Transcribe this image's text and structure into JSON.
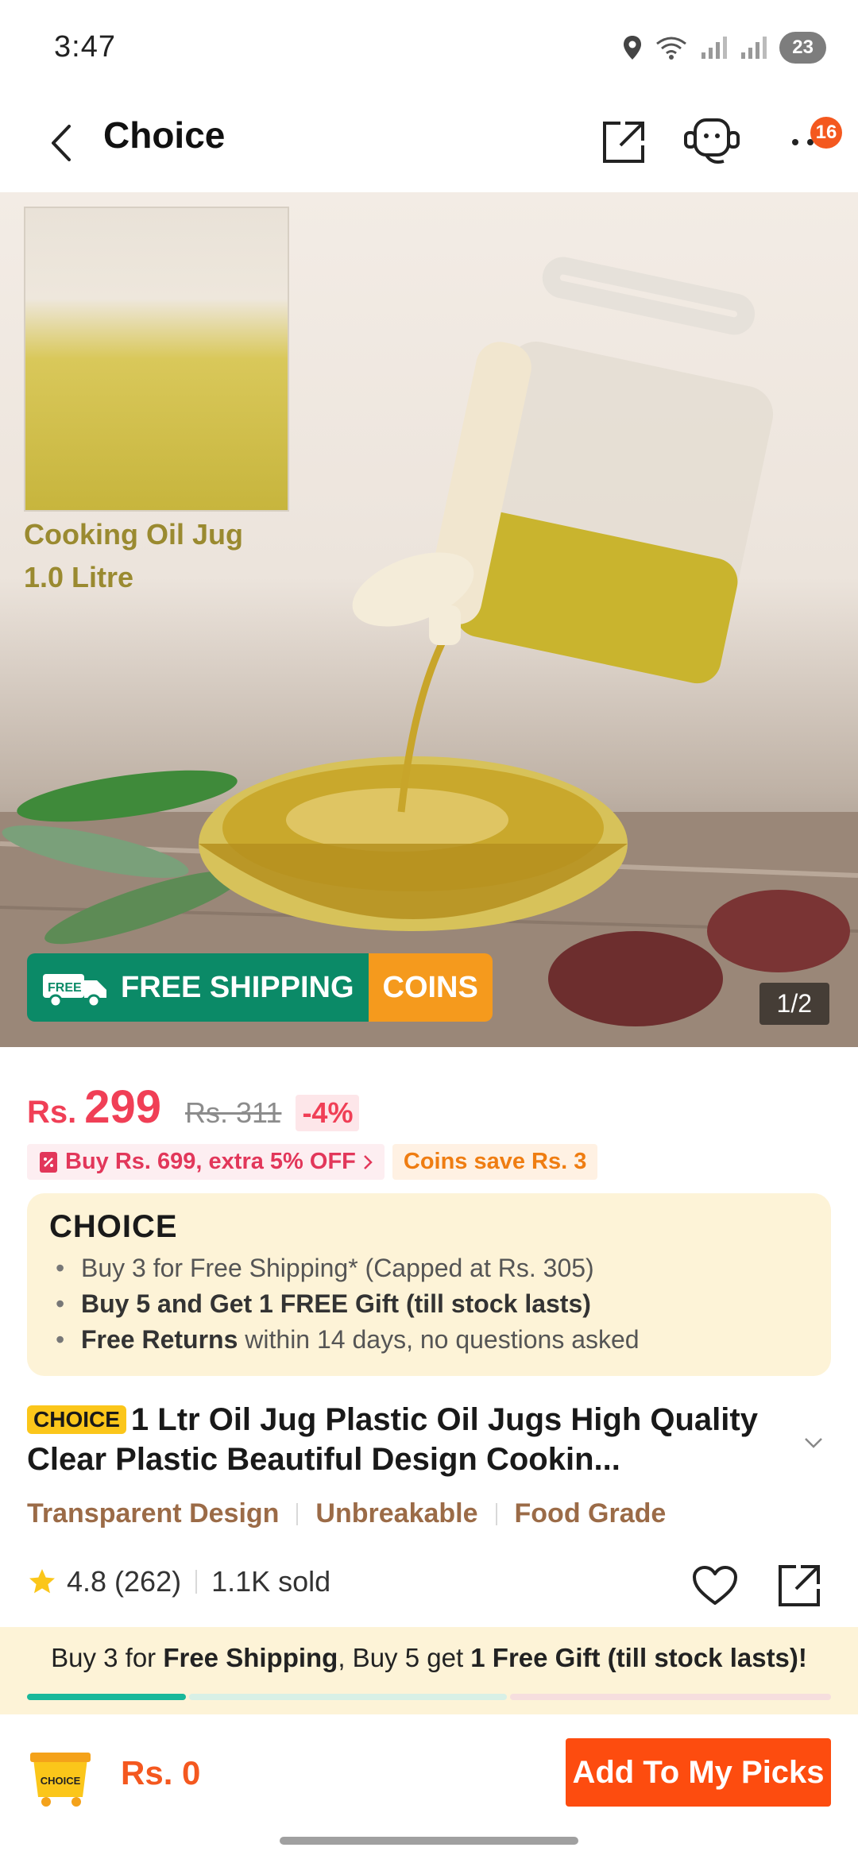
{
  "status_bar": {
    "time": "3:47",
    "battery": "23"
  },
  "header": {
    "title": "Choice",
    "cart_badge": "16"
  },
  "gallery": {
    "inset_caption_line1": "Cooking Oil Jug",
    "inset_caption_line2": "1.0 Litre",
    "free_label": "FREE",
    "shipping_label": "FREE SHIPPING",
    "coins_label": "COINS",
    "counter": "1/2"
  },
  "price": {
    "currency": "Rs.",
    "current": "299",
    "original": "Rs. 311",
    "discount": "-4%"
  },
  "promos": {
    "bundle_offer": "Buy Rs. 699, extra 5% OFF",
    "coins_save": "Coins save Rs. 3"
  },
  "choice_box": {
    "logo": "CHOICE",
    "item1": "Buy 3 for  Free Shipping* (Capped at Rs. 305)",
    "item2": "Buy 5 and Get 1 FREE Gift (till stock lasts)",
    "item3_bold": "Free Returns",
    "item3_rest": " within 14 days, no questions asked"
  },
  "product": {
    "choice_tag": "CHOICE",
    "title": "1 Ltr Oil Jug Plastic Oil Jugs High Quality Clear Plastic Beautiful Design Cookin...",
    "tags": [
      "Transparent Design",
      "Unbreakable",
      "Food Grade"
    ],
    "rating": "4.8 (262)",
    "sold": "1.1K sold"
  },
  "bundle_banner": {
    "part1": "Buy 3 for ",
    "part2": "Free Shipping",
    "part3": ", Buy 5 get ",
    "part4": "1 Free Gift (till stock lasts)!"
  },
  "action_bar": {
    "cart_logo": "CHOICE",
    "total": "Rs. 0",
    "add_button": "Add To My Picks"
  },
  "colors": {
    "accent_red": "#f03f56",
    "orange": "#fd4c0f",
    "green": "#0b8a67",
    "cream": "#fdf3d7"
  }
}
